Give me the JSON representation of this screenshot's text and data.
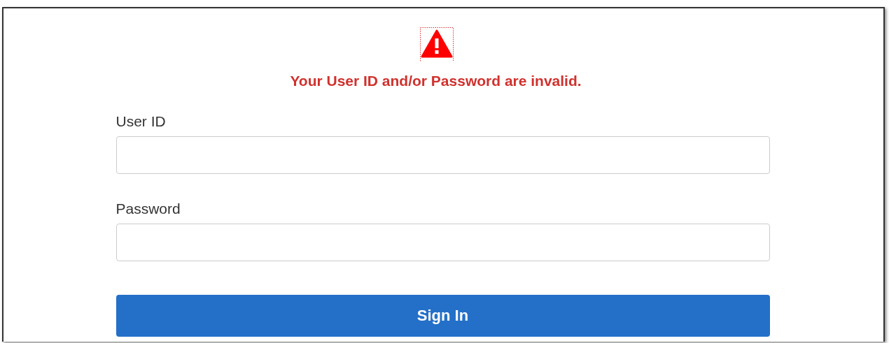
{
  "error": {
    "message": "Your User ID and/or Password are invalid."
  },
  "fields": [
    {
      "label": "User ID"
    },
    {
      "label": "Password"
    }
  ],
  "button": {
    "label": "Sign In"
  }
}
